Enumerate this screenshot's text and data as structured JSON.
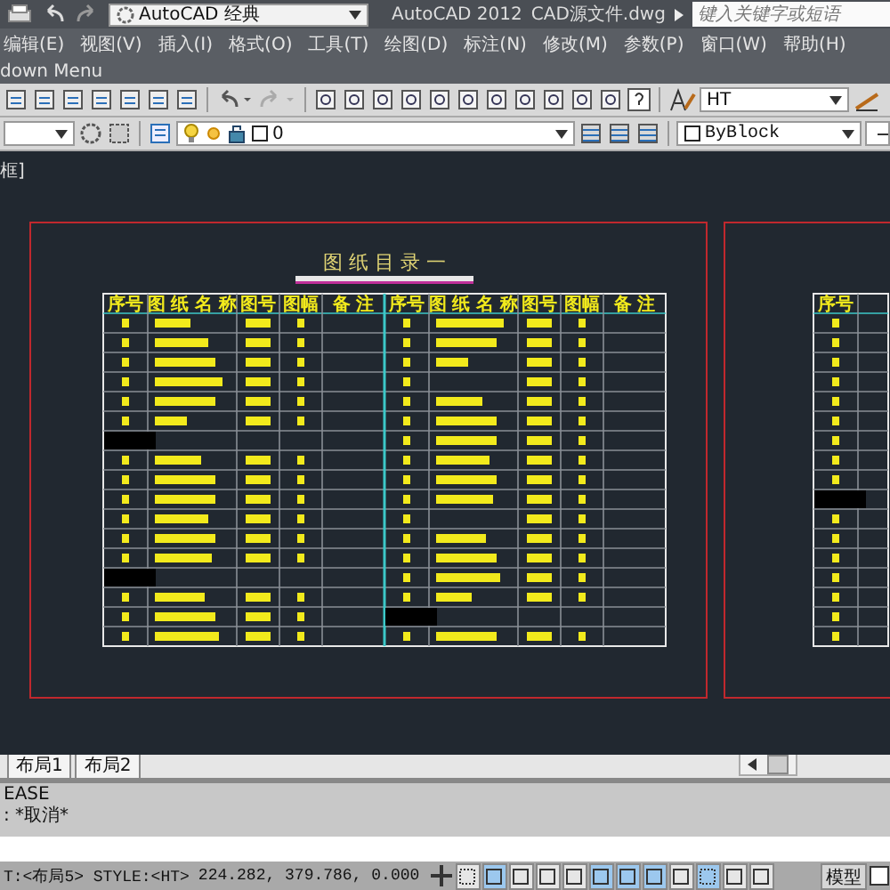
{
  "title_bar": {
    "workspace": "AutoCAD 经典",
    "app": "AutoCAD 2012",
    "file": "CAD源文件.dwg",
    "search": {
      "placeholder": "键入关键字或短语"
    }
  },
  "menu": [
    "编辑(E)",
    "视图(V)",
    "插入(I)",
    "格式(O)",
    "工具(T)",
    "绘图(D)",
    "标注(N)",
    "修改(M)",
    "参数(P)",
    "窗口(W)",
    "帮助(H)"
  ],
  "menu_bar_2": {
    "label": "down Menu"
  },
  "toolbar": {
    "text_style": "HT"
  },
  "layers": {
    "layer": "0",
    "color_control": "ByBlock"
  },
  "viewport_label": "框]",
  "sheet": {
    "title": "图 纸 目 录 一",
    "headers": [
      "序号",
      "图 纸 名 称",
      "图号",
      "图幅",
      "备 注",
      "序号",
      "图 纸 名 称",
      "图号",
      "图幅",
      "备 注"
    ]
  },
  "sheet_2": {
    "headers": [
      "序号"
    ]
  },
  "layout_tabs": [
    "布局1",
    "布局2"
  ],
  "command": {
    "lines": [
      "EASE",
      ": *取消*"
    ]
  },
  "status": {
    "text": "T:<布局5> STYLE:<HT>",
    "coords": "224.282,  379.786, 0.000",
    "space": "模型",
    "toggles": [
      {
        "on": false
      },
      {
        "on": true
      },
      {
        "on": false
      },
      {
        "on": false
      },
      {
        "on": false
      },
      {
        "on": true
      },
      {
        "on": true
      },
      {
        "on": true
      },
      {
        "on": false
      },
      {
        "on": true
      },
      {
        "on": false
      },
      {
        "on": false
      }
    ]
  }
}
